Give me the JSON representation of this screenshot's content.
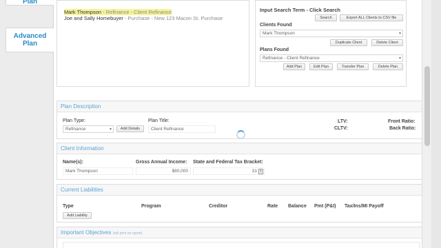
{
  "sidebar": {
    "items": [
      {
        "label": "Plan"
      },
      {
        "label": "Advanced Plan"
      }
    ]
  },
  "clients_list": [
    {
      "name": "Mark Thompson",
      "detail": " - Refinance - Client Refinance"
    },
    {
      "name": "Joe and Sally Homebuyer",
      "detail": " - Purchase - New 123 Macon St. Purchase"
    }
  ],
  "search": {
    "heading": "Input Search Term - Click Search",
    "search_button": "Search",
    "export_button": "Export ALL Clients to CSV file",
    "clients_found_label": "Clients Found",
    "clients_found_value": "Mark Thompson",
    "duplicate_button": "Duplicate Client",
    "delete_client_button": "Delete Client",
    "plans_found_label": "Plans Found",
    "plans_found_value": "Refinance - Client Refinance",
    "add_plan_button": "Add Plan",
    "edit_plan_button": "Edit Plan",
    "transfer_plan_button": "Transfer Plan",
    "delete_plan_button": "Delete Plan"
  },
  "plan_description": {
    "title": "Plan Description",
    "plan_type_label": "Plan Type:",
    "plan_type_value": "Refinance",
    "add_details_button": "Add Details",
    "plan_title_label": "Plan Title:",
    "plan_title_value": "Client Refinance",
    "ltv_label": "LTV:",
    "cltv_label": "CLTV:",
    "front_ratio_label": "Front Ratio:",
    "back_ratio_label": "Back Ratio:"
  },
  "client_info": {
    "title": "Client Information",
    "names_label": "Name(s):",
    "names_value": "Mark Thompson",
    "income_label": "Gross Annual Income:",
    "income_value": "$80,000",
    "tax_label": "State and Federal Tax Bracket:",
    "tax_value": "31"
  },
  "liabilities": {
    "title": "Current Liabilities",
    "columns": [
      "Type",
      "Program",
      "Creditor",
      "Rate",
      "Balance",
      "Pmt (P&I)",
      "Tax/Ins/MI Payoff"
    ],
    "add_button": "Add Liability"
  },
  "objectives": {
    "title": "Important Objectives",
    "note": "(will print on report)"
  }
}
